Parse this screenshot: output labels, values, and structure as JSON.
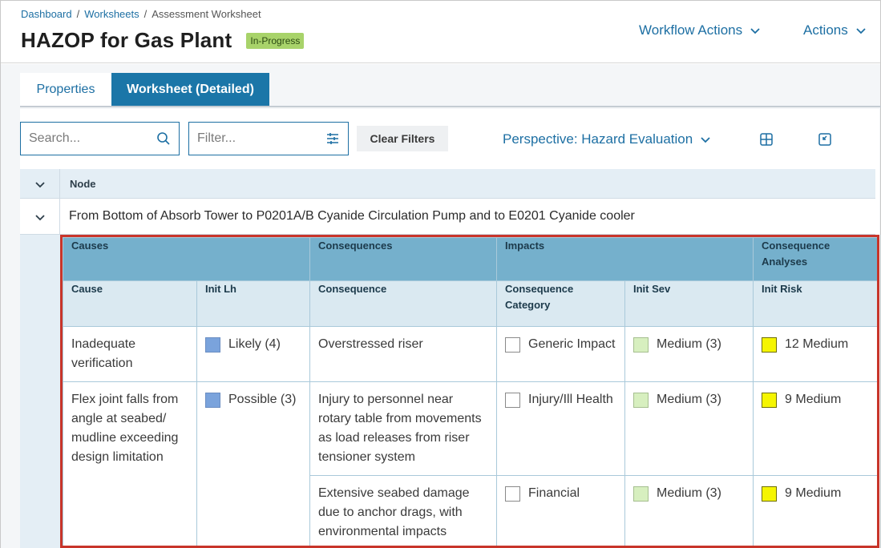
{
  "breadcrumb": {
    "items": [
      "Dashboard",
      "Worksheets"
    ],
    "current": "Assessment Worksheet",
    "separator": "/"
  },
  "header": {
    "title": "HAZOP for Gas Plant",
    "status": "In-Progress",
    "workflow_actions": "Workflow Actions",
    "actions": "Actions"
  },
  "tabs": [
    {
      "label": "Properties",
      "active": false
    },
    {
      "label": "Worksheet (Detailed)",
      "active": true
    }
  ],
  "toolbar": {
    "search_placeholder": "Search...",
    "filter_placeholder": "Filter...",
    "clear_filters": "Clear Filters",
    "perspective": "Perspective: Hazard Evaluation"
  },
  "node": {
    "header": "Node",
    "value": "From Bottom of Absorb Tower to P0201A/B Cyanide Circulation Pump and to E0201 Cyanide cooler"
  },
  "grid": {
    "groups": [
      "Causes",
      "Consequences",
      "Impacts",
      "Consequence Analyses"
    ],
    "columns": [
      "Cause",
      "Init Lh",
      "Consequence",
      "Consequence Category",
      "Init Sev",
      "Init Risk"
    ],
    "rows": [
      {
        "cause": "Inadequate verification",
        "init_lh": "Likely (4)",
        "consequences": [
          {
            "consequence": "Overstressed riser",
            "category": "Generic Impact",
            "init_sev": "Medium (3)",
            "init_risk": "12 Medium"
          }
        ]
      },
      {
        "cause": "Flex joint falls from angle at seabed/ mudline exceeding design limitation",
        "init_lh": "Possible (3)",
        "consequences": [
          {
            "consequence": "Injury to personnel near rotary table from movements as load releases from riser tensioner system",
            "category": "Injury/Ill Health",
            "init_sev": "Medium (3)",
            "init_risk": "9 Medium"
          },
          {
            "consequence": "Extensive seabed damage due to anchor drags, with environmental impacts",
            "category": "Financial",
            "init_sev": "Medium (3)",
            "init_risk": "9 Medium"
          }
        ]
      }
    ]
  },
  "colors": {
    "accent": "#1d6fa3",
    "status_badge": "#a8d36a",
    "likelihood": "#7aa3dc",
    "severity_medium": "#d7efbf",
    "risk_medium": "#f5f500",
    "highlight_border": "#c8352a"
  },
  "icons": [
    "search-icon",
    "filter-settings-icon",
    "chevron-down-icon",
    "grid-layout-icon",
    "collapse-view-icon"
  ]
}
